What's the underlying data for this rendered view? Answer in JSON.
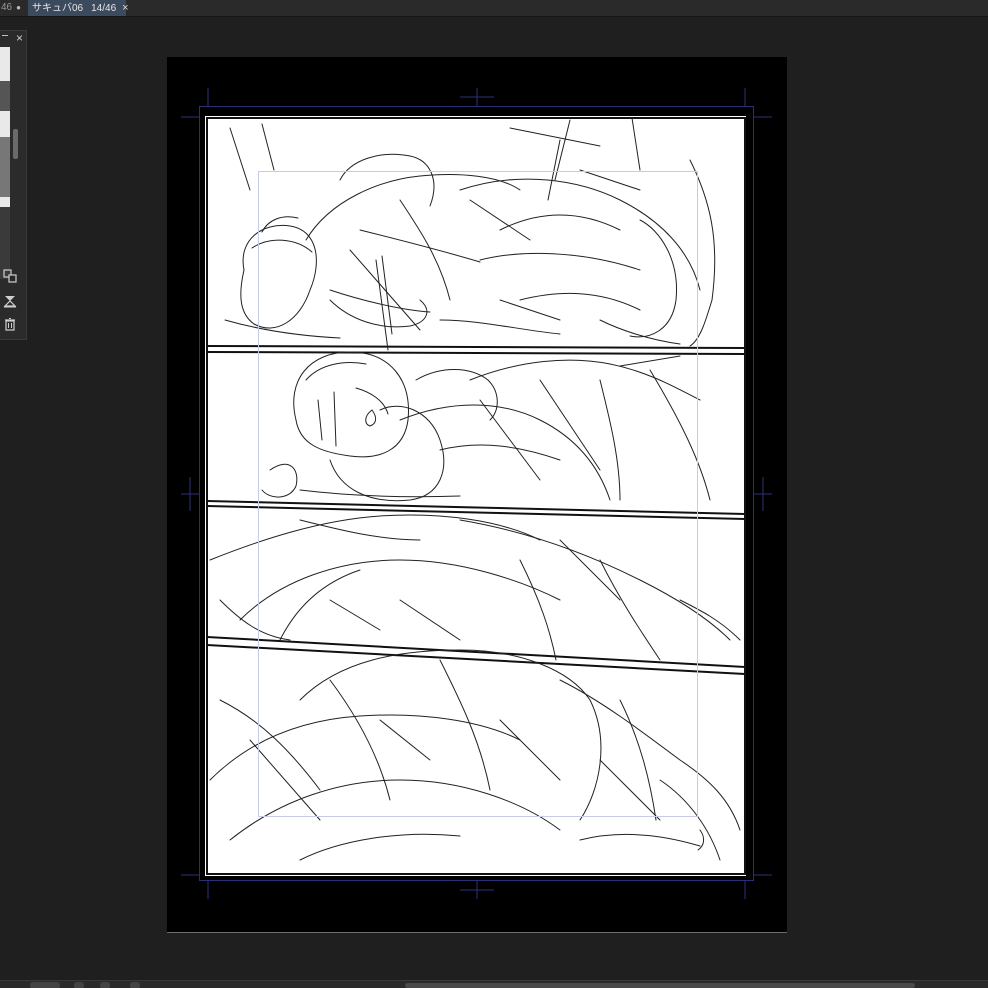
{
  "tabs": {
    "previous": {
      "label": "46",
      "modified_dot": "●"
    },
    "active": {
      "title": "サキュバ06",
      "page": "14/46",
      "close": "×"
    }
  },
  "navigator": {
    "close": "×",
    "buttons": [
      "layer-transfer-icon",
      "merge-down-icon",
      "trash-icon"
    ]
  },
  "canvas": {
    "panels": 4,
    "colors": {
      "background": "#1f1f1f",
      "pasteboard": "#000000",
      "paper": "#ffffff",
      "guide": "#2b2f7a",
      "safe_area": "#c7cbe6"
    }
  }
}
